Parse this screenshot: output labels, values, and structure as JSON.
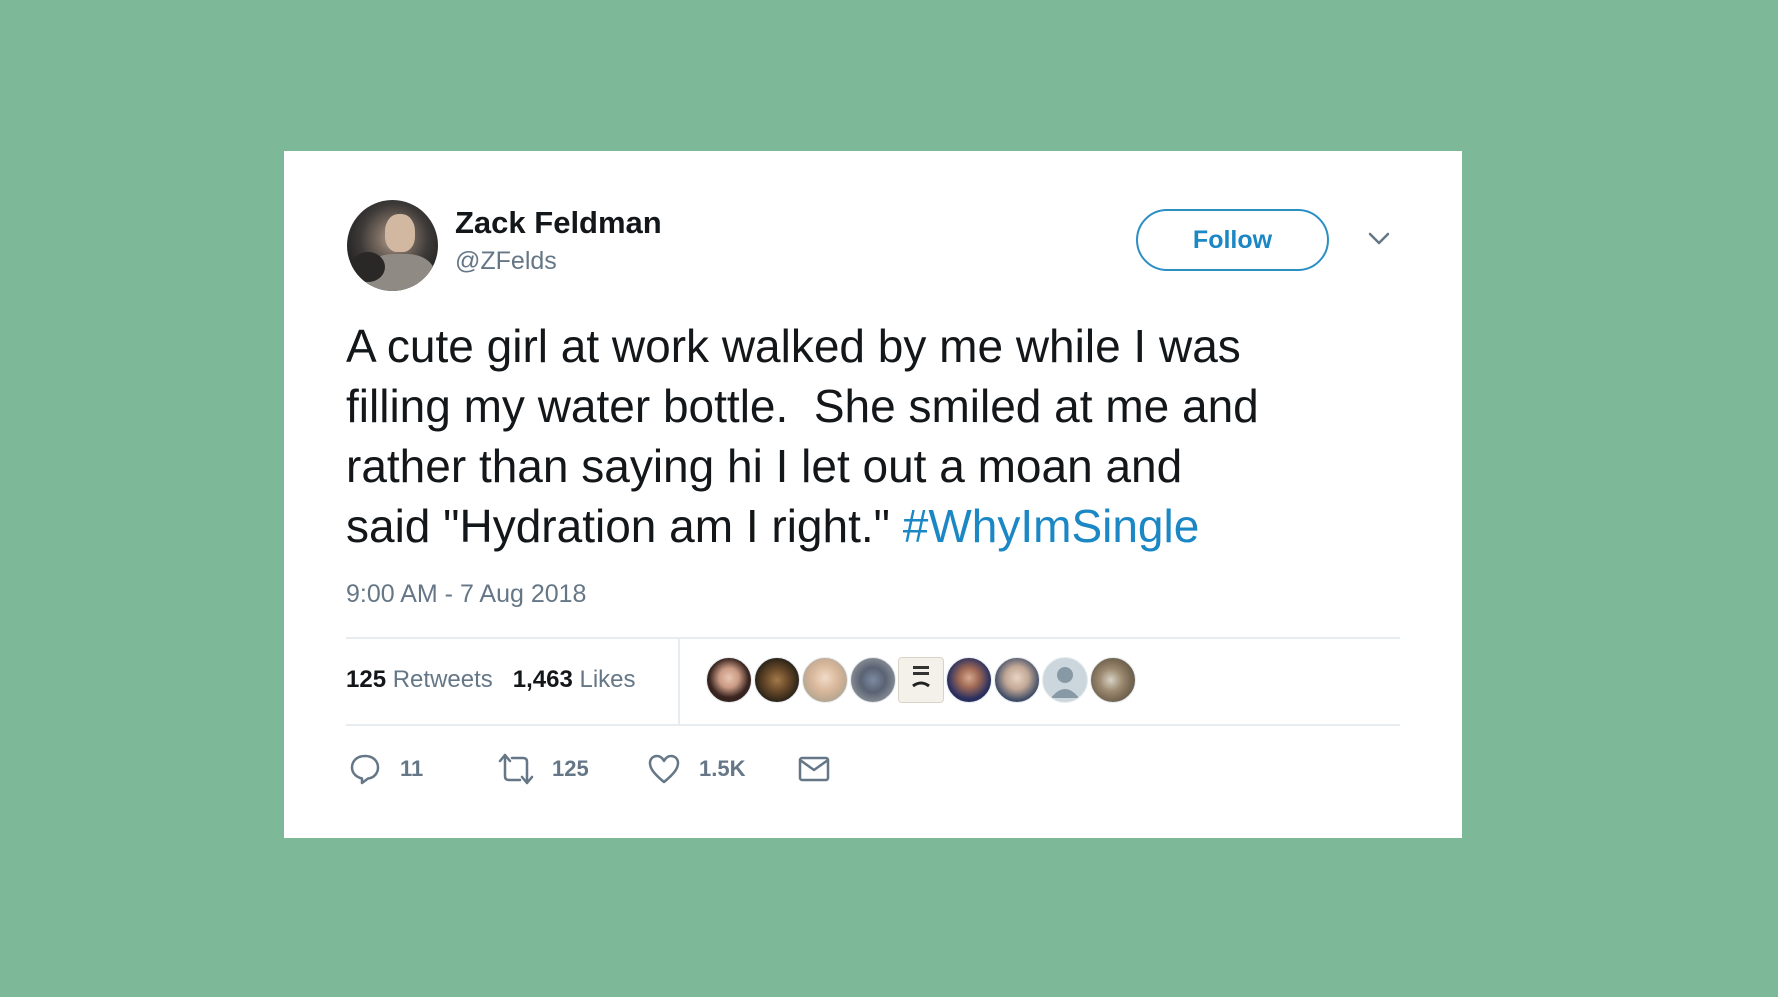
{
  "tweet": {
    "author": {
      "name": "Zack Feldman",
      "handle": "@ZFelds",
      "avatar_icon": "profile-photo"
    },
    "follow_label": "Follow",
    "menu_icon": "chevron-down-icon",
    "text_lines": [
      "A cute girl at work walked by me while I was",
      "filling my water bottle.  She smiled at me and",
      "rather than saying hi I let out a moan and",
      "said \"Hydration am I right.\" "
    ],
    "hashtag": "#WhyImSingle",
    "timestamp": "9:00 AM - 7 Aug 2018",
    "stats": {
      "retweets_count": "125",
      "retweets_label": "Retweets",
      "likes_count": "1,463",
      "likes_label": "Likes"
    },
    "liked_by_avatars": 9,
    "actions": {
      "reply_icon": "reply-icon",
      "reply_count": "11",
      "retweet_icon": "retweet-icon",
      "retweet_count": "125",
      "like_icon": "heart-icon",
      "like_count": "1.5K",
      "dm_icon": "envelope-icon"
    },
    "colors": {
      "background": "#7db898",
      "card": "#ffffff",
      "link": "#1b87c4",
      "muted": "#657786",
      "text": "#14171a"
    }
  }
}
